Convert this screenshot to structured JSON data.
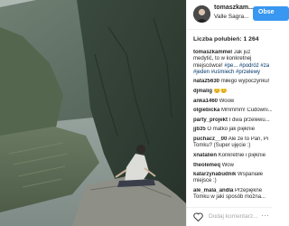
{
  "post": {
    "username": "tomaszkam...",
    "location": "Valle Sagra...",
    "follow_label": "Obse",
    "likes": "Liczba polubień: 1 264",
    "add_comment_placeholder": "Dodaj komentarz...",
    "more_options": "⋯"
  },
  "comments": [
    {
      "user": "tomaszkammel",
      "text": "Jak już medytić, to w konkretnej miejscówce!",
      "tags": "#pe... #podróż #za #jeden #uśmiech #przelewy",
      "lines": 4
    },
    {
      "user": "nata25630",
      "text": "miłego wypoczynku!",
      "lines": 1
    },
    {
      "user": "djmalig",
      "text": "😊😊",
      "lines": 1
    },
    {
      "user": "anka1460",
      "text": "Woow",
      "lines": 1
    },
    {
      "user": "olgiebicka",
      "text": "Mmmmm! Cudowni...",
      "lines": 1
    },
    {
      "user": "party_projekt",
      "text": "I dwa przelewu...",
      "lines": 1
    },
    {
      "user": "jjb35",
      "text": "O matko jak pięknie",
      "lines": 1
    },
    {
      "user": "puchacz__00",
      "text": "Ale ze to Pan, Pi Tomku? (Super ujęcie :)",
      "lines": 2
    },
    {
      "user": "xnatalien",
      "text": "Konkretnie i pięknie",
      "lines": 1
    },
    {
      "user": "theolemeq",
      "text": "Wow",
      "lines": 1
    },
    {
      "user": "katarzynabudnik",
      "text": "Wspaniałe miejsce :)",
      "lines": 2
    },
    {
      "user": "ale_mala_andla",
      "text": "Przepiękne Tomku w jaki sposób można...",
      "lines": 2
    }
  ]
}
